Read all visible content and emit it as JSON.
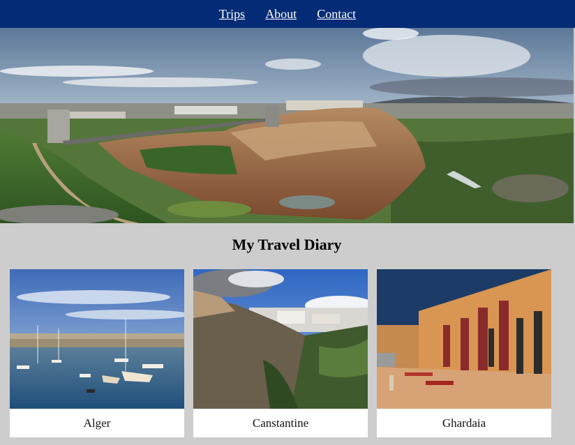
{
  "nav": {
    "items": [
      {
        "label": "Trips"
      },
      {
        "label": "About"
      },
      {
        "label": "Contact"
      }
    ]
  },
  "main": {
    "title": "My Travel Diary",
    "cards": [
      {
        "caption": "Alger"
      },
      {
        "caption": "Canstantine"
      },
      {
        "caption": "Ghardaia"
      }
    ]
  },
  "colors": {
    "nav_bg": "#042b75",
    "page_bg": "#cdcdcd",
    "card_bg": "#ffffff"
  }
}
